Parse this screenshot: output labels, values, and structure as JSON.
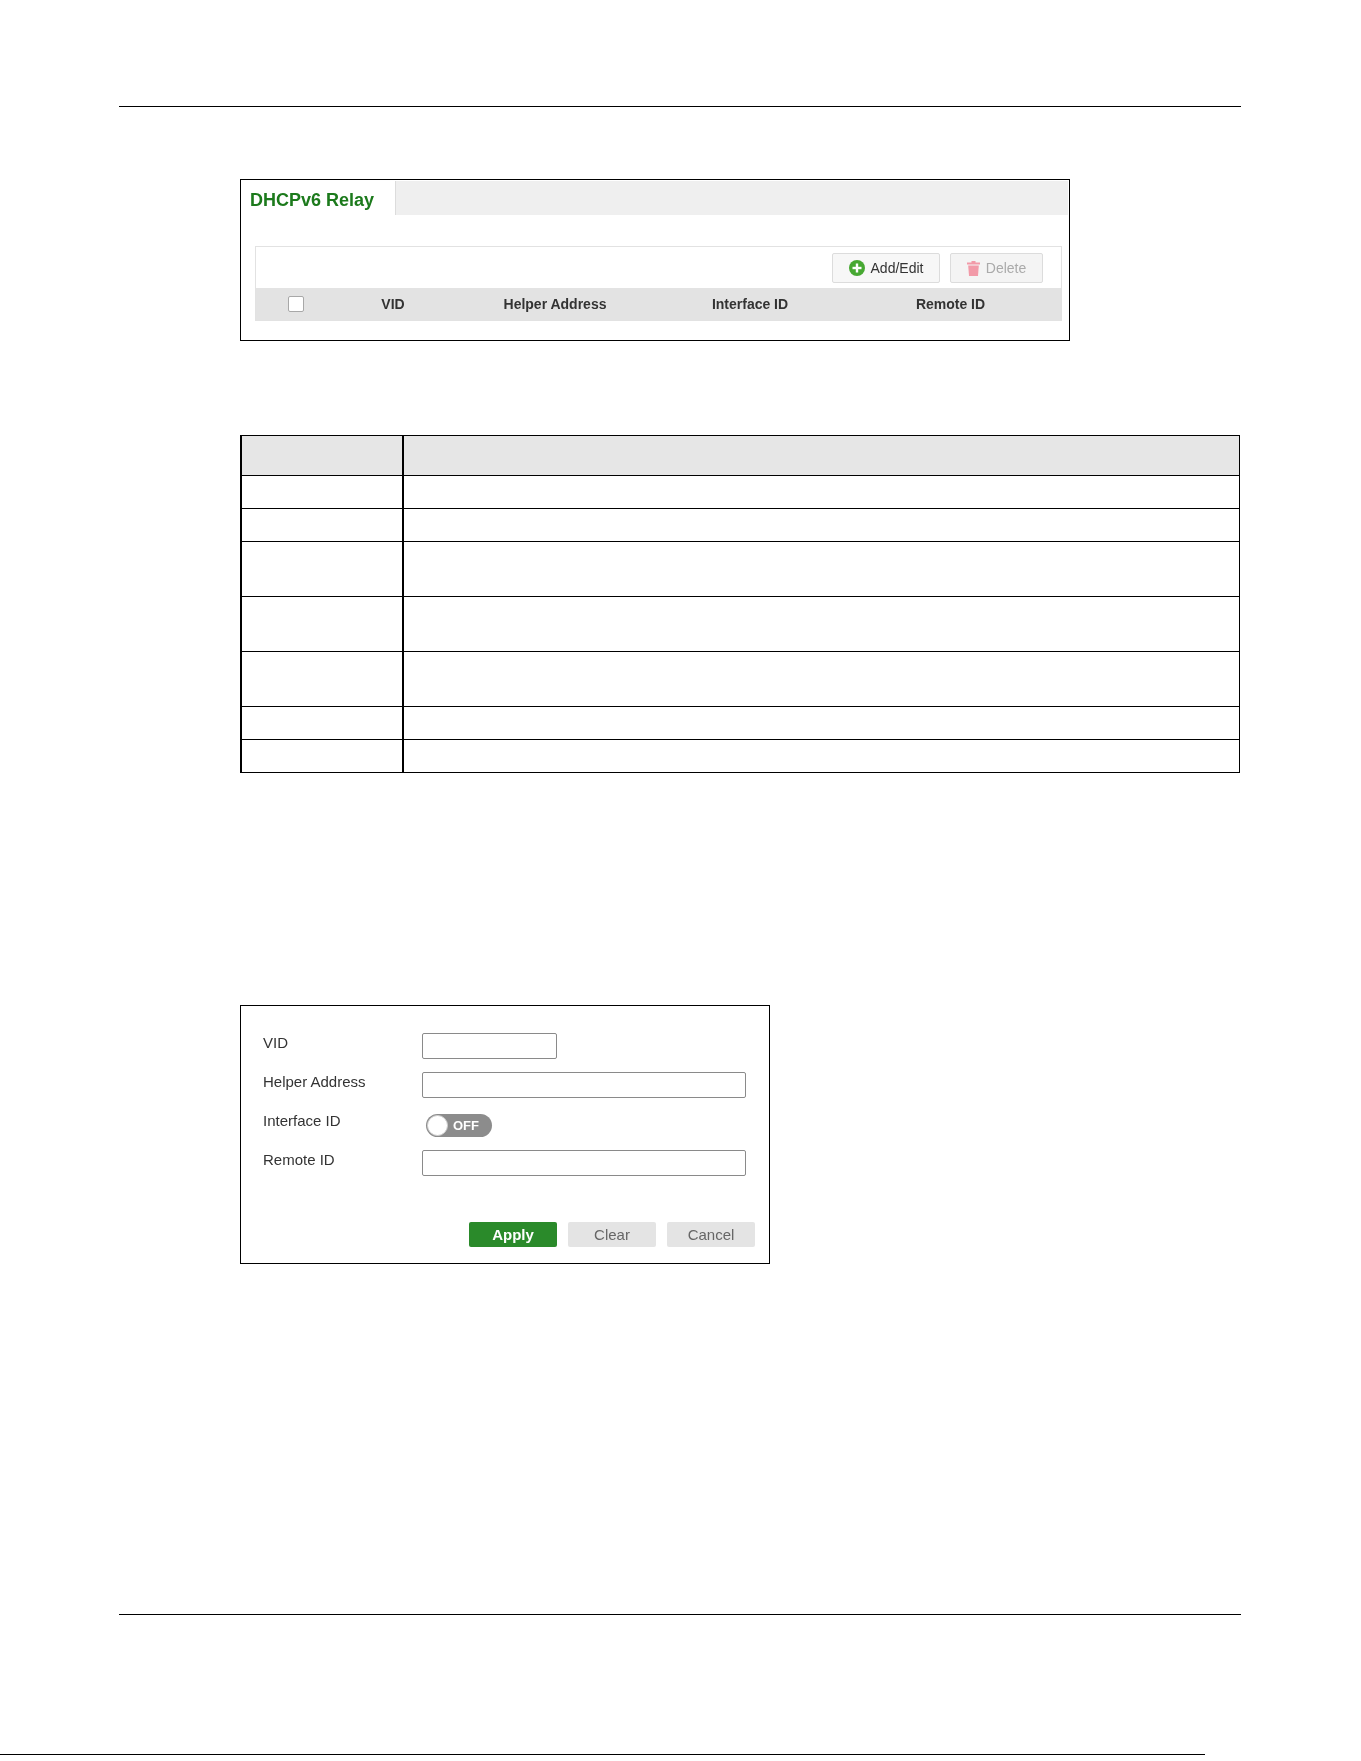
{
  "relay_panel": {
    "tabs": [
      {
        "label": "DHCPv6 Relay",
        "selected": true
      }
    ],
    "actions": [
      {
        "kind": "add",
        "label": "Add/Edit",
        "disabled": false
      },
      {
        "kind": "delete",
        "label": "Delete",
        "disabled": true
      }
    ],
    "select_all": {
      "checked": false
    },
    "columns": [
      "VID",
      "Helper Address",
      "Interface ID",
      "Remote ID"
    ]
  },
  "table": {
    "rows": [
      {
        "kind": "header"
      },
      {
        "kind": "single"
      },
      {
        "kind": "single"
      },
      {
        "kind": "double"
      },
      {
        "kind": "double"
      },
      {
        "kind": "double"
      },
      {
        "kind": "single"
      },
      {
        "kind": "single"
      }
    ]
  },
  "form": {
    "fields": [
      {
        "kind": "short_text",
        "label": "VID"
      },
      {
        "kind": "text",
        "label": "Helper Address"
      },
      {
        "kind": "toggle",
        "label": "Interface ID",
        "on": false,
        "state_label": "OFF"
      },
      {
        "kind": "text",
        "label": "Remote ID"
      }
    ],
    "buttons": [
      {
        "kind": "primary",
        "label": "Apply"
      },
      {
        "kind": "secondary",
        "label": "Clear"
      },
      {
        "kind": "secondary",
        "label": "Cancel"
      }
    ]
  }
}
